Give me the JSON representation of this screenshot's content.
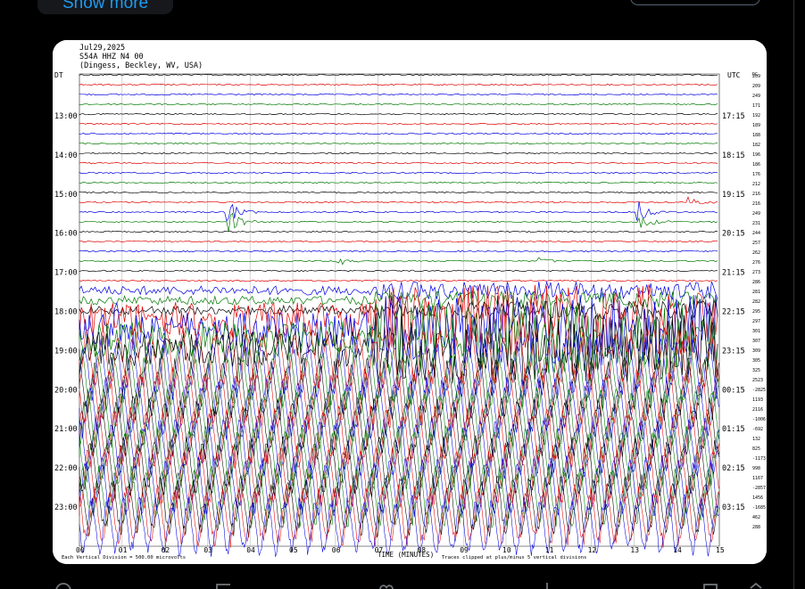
{
  "post": {
    "show_more_label": "Show more"
  },
  "seismogram": {
    "date": "Jul29,2025",
    "station": "S54A HHZ N4 00",
    "location": "(Dingess, Beckley, WV, USA)",
    "left_zone": "DT",
    "right_zone": "UTC",
    "right_header_small": "DC",
    "left_hours": [
      "13:00",
      "14:00",
      "15:00",
      "16:00",
      "17:00",
      "18:00",
      "19:00",
      "20:00",
      "21:00",
      "22:00",
      "23:00"
    ],
    "right_hours": [
      "17:15",
      "18:15",
      "19:15",
      "20:15",
      "21:15",
      "22:15",
      "23:15",
      "00:15",
      "01:15",
      "02:15",
      "03:15"
    ],
    "right_offsets": [
      "209",
      "209",
      "249",
      "171",
      "192",
      "189",
      "188",
      "182",
      "196",
      "186",
      "176",
      "212",
      "216",
      "216",
      "249",
      "231",
      "244",
      "257",
      "262",
      "276",
      "273",
      "286",
      "281",
      "282",
      "295",
      "297",
      "301",
      "307",
      "309",
      "305",
      "325",
      "2523",
      "-2825",
      "1193",
      "2116",
      "-1006",
      "-692",
      "132",
      "825",
      "-1173",
      "998",
      "1167",
      "-2857",
      "1456",
      "-1685",
      "462",
      "288"
    ],
    "x_ticks": [
      "00",
      "01",
      "02",
      "03",
      "04",
      "05",
      "06",
      "07",
      "08",
      "09",
      "10",
      "11",
      "12",
      "13",
      "14",
      "15"
    ],
    "x_axis_label": "TIME (MINUTES)",
    "division_note": "Each Vertical Division = 500.00 microvolts",
    "clip_note": "Traces clipped at plus/minus 5 vertical divisions",
    "trace_colors": [
      "#000000",
      "#e00000",
      "#0000e0",
      "#007a00"
    ]
  }
}
